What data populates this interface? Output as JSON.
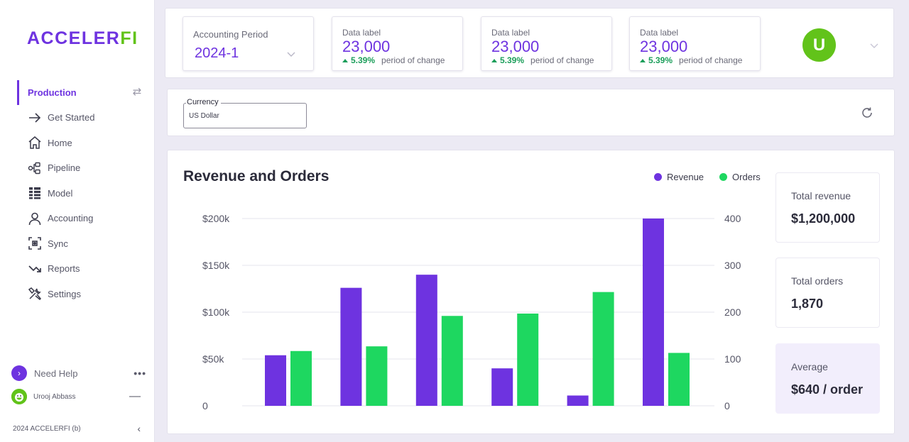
{
  "brand": {
    "part1": "ACCELER",
    "part2": "FI"
  },
  "sidebar": {
    "env_label": "Production",
    "items": [
      {
        "label": "Get Started",
        "icon": "arrow-right-icon"
      },
      {
        "label": "Home",
        "icon": "home-icon"
      },
      {
        "label": "Pipeline",
        "icon": "pipeline-icon"
      },
      {
        "label": "Model",
        "icon": "model-icon"
      },
      {
        "label": "Accounting",
        "icon": "user-icon"
      },
      {
        "label": "Sync",
        "icon": "sync-icon"
      },
      {
        "label": "Reports",
        "icon": "reports-icon"
      },
      {
        "label": "Settings",
        "icon": "settings-icon"
      }
    ],
    "help_label": "Need Help",
    "more": "•••",
    "user_name": "Urooj Abbass",
    "footer": "2024 ACCELERFI (b)"
  },
  "topbar": {
    "period_label": "Accounting Period",
    "period_value": "2024-1",
    "kpis": [
      {
        "label": "Data label",
        "value": "23,000",
        "change": "5.39%",
        "desc": "period of change"
      },
      {
        "label": "Data label",
        "value": "23,000",
        "change": "5.39%",
        "desc": "period of change"
      },
      {
        "label": "Data label",
        "value": "23,000",
        "change": "5.39%",
        "desc": "period of change"
      }
    ],
    "avatar_initial": "U"
  },
  "currency": {
    "label": "Currency",
    "value": "US Dollar"
  },
  "colors": {
    "accent": "#6e33e0",
    "brand_green": "#62c31a",
    "orders_green": "#1ed760",
    "positive": "#1b9e5a"
  },
  "stats": {
    "total_revenue_label": "Total revenue",
    "total_revenue_value": "$1,200,000",
    "total_orders_label": "Total orders",
    "total_orders_value": "1,870",
    "average_label": "Average",
    "average_value": "$640 / order"
  },
  "chart_data": {
    "type": "bar",
    "title": "Revenue and Orders",
    "legend": [
      "Revenue",
      "Orders"
    ],
    "legend_position": "top-right",
    "grid": true,
    "categories": [
      "",
      "",
      "",
      "",
      "",
      ""
    ],
    "series": [
      {
        "name": "Revenue",
        "axis": "left",
        "color": "#6e33e0",
        "values": [
          54000,
          126000,
          140000,
          40000,
          11000,
          200000
        ]
      },
      {
        "name": "Orders",
        "axis": "right",
        "color": "#1ed760",
        "values": [
          117,
          127,
          192,
          197,
          243,
          113
        ]
      }
    ],
    "y_left": {
      "ylim": [
        0,
        200000
      ],
      "ticks": [
        0,
        50000,
        100000,
        150000,
        200000
      ],
      "tick_labels": [
        "0",
        "$50k",
        "$100k",
        "$150k",
        "$200k"
      ]
    },
    "y_right": {
      "ylim": [
        0,
        400
      ],
      "ticks": [
        0,
        100,
        200,
        300,
        400
      ],
      "tick_labels": [
        "0",
        "100",
        "200",
        "300",
        "400"
      ]
    }
  }
}
